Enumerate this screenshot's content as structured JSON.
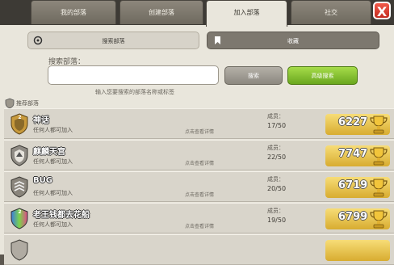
{
  "tabs": [
    {
      "label": "我的部落"
    },
    {
      "label": "创建部落"
    },
    {
      "label": "加入部落"
    },
    {
      "label": "社交"
    }
  ],
  "close_label": "X",
  "toggles": {
    "search_label": "搜索部落",
    "bookmarks_label": "收藏"
  },
  "search": {
    "label": "搜索部落：",
    "value": "",
    "search_button": "搜索",
    "advanced_button": "高级搜索",
    "hint": "输入您要搜索的部落名称或标签"
  },
  "recommended_label": "推荐部落",
  "member_label": "成员：",
  "clans": [
    {
      "level": "2",
      "name": "神话",
      "join": "任何人都可加入",
      "detail": "点击查看详情",
      "members": "17/50",
      "trophies": "6227"
    },
    {
      "level": "",
      "name": "麒麟天宫",
      "join": "任何人都可加入",
      "detail": "点击查看详情",
      "members": "22/50",
      "trophies": "7747"
    },
    {
      "level": "",
      "name": "BUG",
      "join": "任何人都可加入",
      "detail": "点击查看详情",
      "members": "20/50",
      "trophies": "6719"
    },
    {
      "level": "2",
      "name": "老王钱都去花船",
      "join": "任何人都可加入",
      "detail": "点击查看详情",
      "members": "19/50",
      "trophies": "6799"
    },
    {
      "level": "",
      "name": "",
      "join": "",
      "detail": "",
      "members": "",
      "trophies": ""
    }
  ],
  "colors": {
    "accent_green": "#7cba2a",
    "trophy_gold": "#e8c04a",
    "panel": "#e9e6dc"
  }
}
